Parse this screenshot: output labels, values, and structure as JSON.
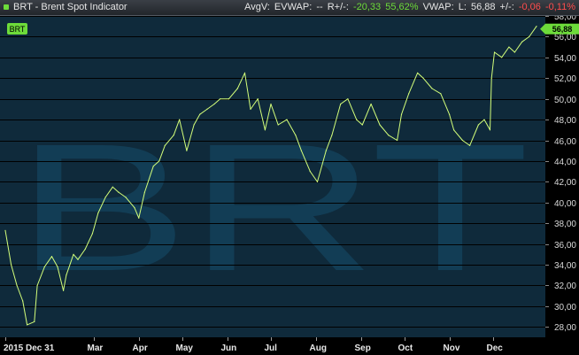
{
  "header": {
    "title": "BRT - Brent Spot Indicator",
    "avgv_label": "AvgV:",
    "evwap_label": "EVWAP:",
    "evwap_value": "--",
    "rchange_label": "R+/-:",
    "rchange_value": "-20,33",
    "rchange_pct": "55,62%",
    "vwap_label": "VWAP:",
    "last_label": "L:",
    "last_value": "56,88",
    "change_label": "+/-:",
    "change_value": "-0,06",
    "change_pct": "-0,11%"
  },
  "colors": {
    "background": "#0f2a3b",
    "line": "#d4ff7a",
    "watermark": "#123d55",
    "gridline": "#000000",
    "positive": "#6ddb3a",
    "negative": "#ff4d4d"
  },
  "chart_data": {
    "type": "line",
    "symbol": "BRT",
    "watermark": "BRT",
    "last_value_label": "56,88",
    "ylim": [
      27,
      58
    ],
    "yticks": [
      "58,00",
      "56,00",
      "54,00",
      "52,00",
      "50,00",
      "48,00",
      "46,00",
      "44,00",
      "42,00",
      "40,00",
      "38,00",
      "36,00",
      "34,00",
      "32,00",
      "30,00",
      "28,00"
    ],
    "ytick_values": [
      58,
      56,
      54,
      52,
      50,
      48,
      46,
      44,
      42,
      40,
      38,
      36,
      34,
      32,
      30,
      28
    ],
    "xlim": [
      "2015-12-31",
      "2016-12-31"
    ],
    "xticks": [
      {
        "label": "2015 Dec 31",
        "date": "2015-12-31"
      },
      {
        "label": "Mar",
        "date": "2016-03-01"
      },
      {
        "label": "Apr",
        "date": "2016-04-01"
      },
      {
        "label": "May",
        "date": "2016-05-01"
      },
      {
        "label": "Jun",
        "date": "2016-06-01"
      },
      {
        "label": "Jul",
        "date": "2016-07-01"
      },
      {
        "label": "Aug",
        "date": "2016-08-01"
      },
      {
        "label": "Sep",
        "date": "2016-09-01"
      },
      {
        "label": "Oct",
        "date": "2016-10-01"
      },
      {
        "label": "Nov",
        "date": "2016-11-01"
      },
      {
        "label": "Dec",
        "date": "2016-12-01"
      }
    ],
    "grid": true,
    "series": [
      {
        "x": [
          "2015-12-31",
          "2016-01-04",
          "2016-01-08",
          "2016-01-12",
          "2016-01-15",
          "2016-01-20",
          "2016-01-22",
          "2016-01-27",
          "2016-02-01",
          "2016-02-05",
          "2016-02-09",
          "2016-02-11",
          "2016-02-16",
          "2016-02-19",
          "2016-02-24",
          "2016-02-29",
          "2016-03-04",
          "2016-03-09",
          "2016-03-14",
          "2016-03-18",
          "2016-03-23",
          "2016-03-29",
          "2016-04-01",
          "2016-04-05",
          "2016-04-11",
          "2016-04-15",
          "2016-04-19",
          "2016-04-25",
          "2016-04-29",
          "2016-05-04",
          "2016-05-09",
          "2016-05-13",
          "2016-05-18",
          "2016-05-23",
          "2016-05-27",
          "2016-06-02",
          "2016-06-08",
          "2016-06-13",
          "2016-06-17",
          "2016-06-22",
          "2016-06-27",
          "2016-07-01",
          "2016-07-06",
          "2016-07-12",
          "2016-07-18",
          "2016-07-22",
          "2016-07-28",
          "2016-08-02",
          "2016-08-08",
          "2016-08-12",
          "2016-08-18",
          "2016-08-23",
          "2016-08-29",
          "2016-09-02",
          "2016-09-08",
          "2016-09-14",
          "2016-09-20",
          "2016-09-26",
          "2016-09-29",
          "2016-10-04",
          "2016-10-10",
          "2016-10-14",
          "2016-10-20",
          "2016-10-26",
          "2016-11-01",
          "2016-11-04",
          "2016-11-10",
          "2016-11-15",
          "2016-11-21",
          "2016-11-25",
          "2016-11-29",
          "2016-11-30",
          "2016-12-02",
          "2016-12-07",
          "2016-12-12",
          "2016-12-16",
          "2016-12-21",
          "2016-12-26",
          "2016-12-31"
        ],
        "values": [
          37.3,
          34.0,
          32.0,
          30.5,
          28.2,
          28.5,
          32.0,
          33.8,
          34.8,
          33.8,
          31.5,
          33.0,
          35.0,
          34.5,
          35.5,
          37.0,
          39.0,
          40.5,
          41.5,
          41.0,
          40.5,
          39.5,
          38.5,
          41.0,
          43.5,
          44.0,
          45.5,
          46.5,
          48.0,
          45.0,
          47.5,
          48.5,
          49.0,
          49.5,
          50.0,
          50.0,
          51.0,
          52.5,
          49.0,
          50.0,
          47.0,
          49.5,
          47.5,
          48.0,
          46.5,
          45.0,
          43.0,
          42.0,
          45.0,
          46.5,
          49.5,
          50.0,
          48.0,
          47.5,
          49.5,
          47.5,
          46.5,
          46.0,
          48.5,
          50.5,
          52.5,
          52.0,
          51.0,
          50.5,
          48.5,
          47.0,
          46.0,
          45.5,
          47.5,
          48.0,
          47.0,
          52.0,
          54.5,
          54.0,
          55.0,
          54.5,
          55.5,
          56.0,
          57.0
        ]
      }
    ]
  }
}
